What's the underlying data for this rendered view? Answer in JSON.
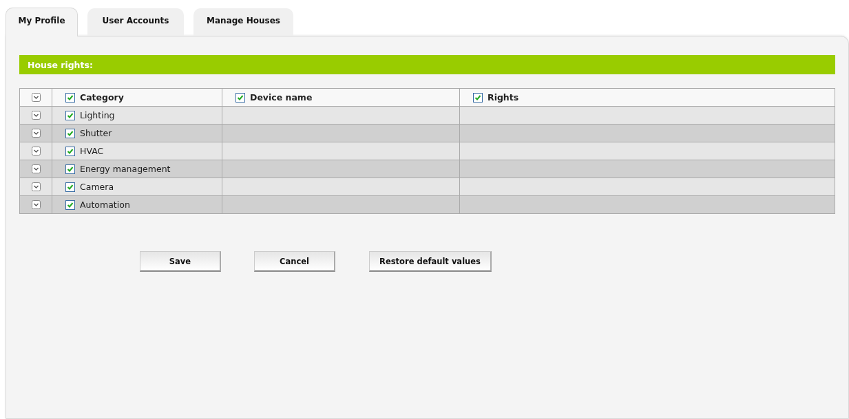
{
  "tabs": [
    {
      "label": "My Profile",
      "selected": true
    },
    {
      "label": "User Accounts",
      "selected": false
    },
    {
      "label": "Manage Houses",
      "selected": false
    }
  ],
  "section_title": "House rights:",
  "table": {
    "header": {
      "expanded": false,
      "columns": [
        {
          "label": "Category",
          "checked": true
        },
        {
          "label": "Device name",
          "checked": true
        },
        {
          "label": "Rights",
          "checked": true
        }
      ]
    },
    "rows": [
      {
        "category": "Lighting",
        "checked": true,
        "expanded": false
      },
      {
        "category": "Shutter",
        "checked": true,
        "expanded": false
      },
      {
        "category": "HVAC",
        "checked": true,
        "expanded": false
      },
      {
        "category": "Energy management",
        "checked": true,
        "expanded": false
      },
      {
        "category": "Camera",
        "checked": true,
        "expanded": false
      },
      {
        "category": "Automation",
        "checked": true,
        "expanded": false
      }
    ]
  },
  "buttons": [
    "Save",
    "Cancel",
    "Restore default values"
  ]
}
